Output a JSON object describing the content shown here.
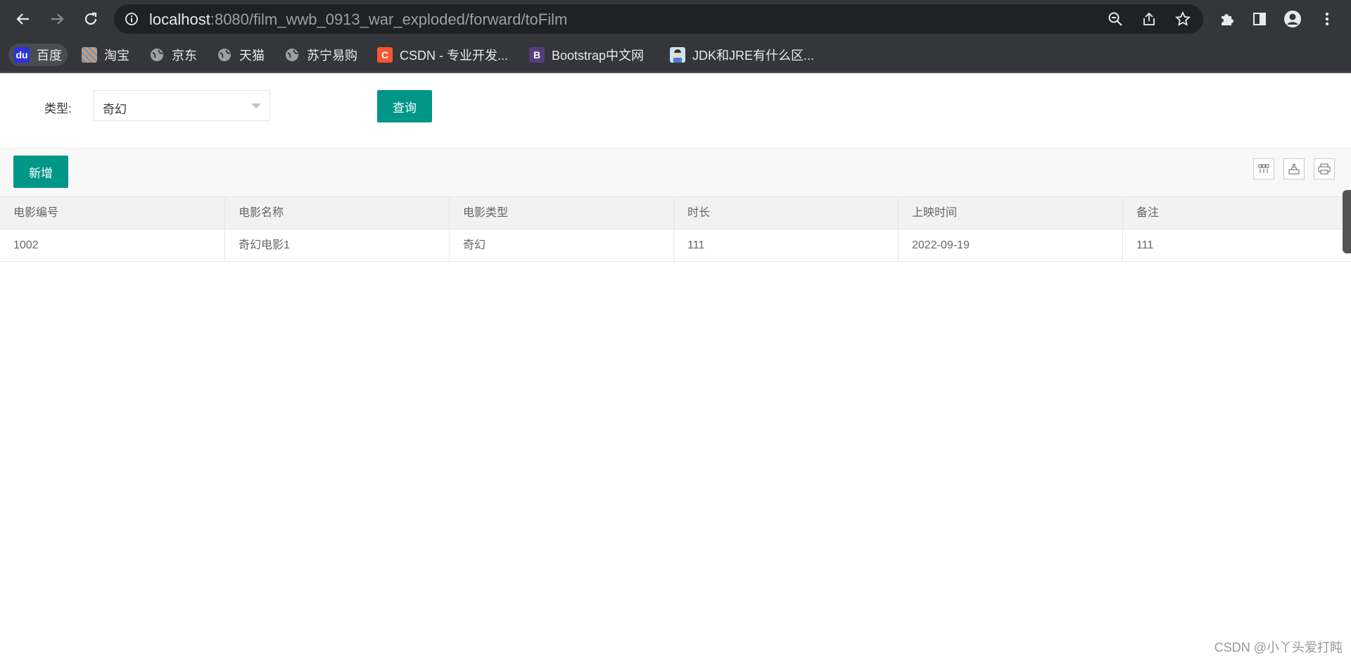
{
  "browser": {
    "url_host": "localhost",
    "url_rest": ":8080/film_wwb_0913_war_exploded/forward/toFilm",
    "bookmarks": [
      {
        "label": "百度",
        "icon": "baidu-icon"
      },
      {
        "label": "淘宝",
        "icon": "taobao-icon"
      },
      {
        "label": "京东",
        "icon": "globe-icon"
      },
      {
        "label": "天猫",
        "icon": "globe-icon"
      },
      {
        "label": "苏宁易购",
        "icon": "globe-icon"
      },
      {
        "label": "CSDN - 专业开发...",
        "icon": "csdn-icon"
      },
      {
        "label": "Bootstrap中文网",
        "icon": "bootstrap-icon"
      },
      {
        "label": "JDK和JRE有什么区...",
        "icon": "avatar-icon"
      }
    ]
  },
  "search": {
    "label": "类型:",
    "selected": "奇幻",
    "query_button": "查询"
  },
  "toolbar": {
    "add_button": "新增"
  },
  "table": {
    "headers": [
      "电影编号",
      "电影名称",
      "电影类型",
      "时长",
      "上映时间",
      "备注"
    ],
    "rows": [
      [
        "1002",
        "奇幻电影1",
        "奇幻",
        "111",
        "2022-09-19",
        "111"
      ]
    ]
  },
  "watermark": "CSDN @小丫头爱打盹",
  "colors": {
    "primary": "#009688",
    "chrome_bg": "#35363a",
    "omnibox_bg": "#202124"
  }
}
